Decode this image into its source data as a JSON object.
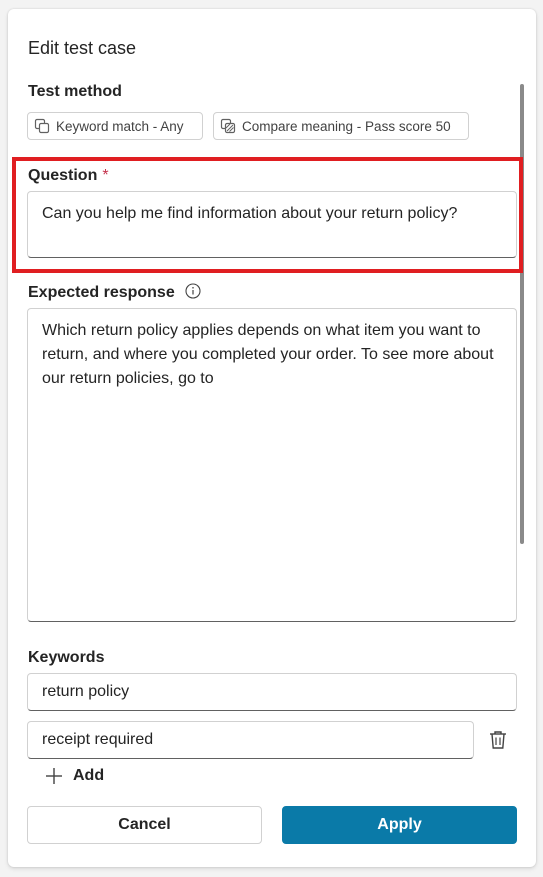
{
  "panel": {
    "title": "Edit test case"
  },
  "test_method": {
    "label": "Test method",
    "options": [
      {
        "label": "Keyword match - Any",
        "icon": "keyword-match-icon"
      },
      {
        "label": "Compare meaning - Pass score 50",
        "icon": "compare-meaning-icon"
      }
    ]
  },
  "question": {
    "label": "Question",
    "required_marker": "*",
    "value": "Can you help me find information about your return policy?"
  },
  "expected_response": {
    "label": "Expected response",
    "icon": "info-icon",
    "value": "Which return policy applies depends on what item you want to return, and where you completed your order. To see more about our return policies, go to"
  },
  "keywords": {
    "label": "Keywords",
    "items": [
      {
        "value": "return policy"
      },
      {
        "value": "receipt required"
      }
    ],
    "add_label": "Add"
  },
  "footer": {
    "cancel_label": "Cancel",
    "apply_label": "Apply"
  },
  "colors": {
    "accent": "#0a7aa8",
    "highlight": "#e01e21",
    "required": "#c4314b"
  }
}
